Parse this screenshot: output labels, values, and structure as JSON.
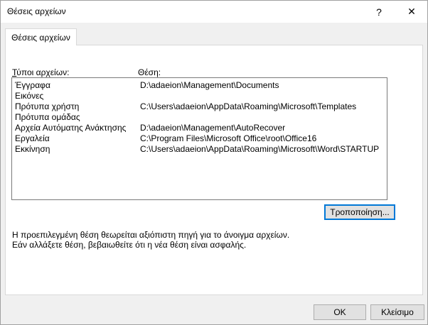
{
  "window": {
    "title": "Θέσεις αρχείων",
    "help_glyph": "?",
    "close_glyph": "✕"
  },
  "tab": {
    "label": "Θέσεις αρχείων"
  },
  "columns": {
    "types_label_first": "Τ",
    "types_label_rest": "ύποι αρχείων:",
    "location_label": "Θέση:"
  },
  "rows": [
    {
      "type": "Έγγραφα",
      "location": "D:\\adaeion\\Management\\Documents"
    },
    {
      "type": "Εικόνες",
      "location": ""
    },
    {
      "type": "Πρότυπα χρήστη",
      "location": "C:\\Users\\adaeion\\AppData\\Roaming\\Microsoft\\Templates"
    },
    {
      "type": "Πρότυπα ομάδας",
      "location": ""
    },
    {
      "type": "Αρχεία Αυτόματης Ανάκτησης",
      "location": "D:\\adaeion\\Management\\AutoRecover"
    },
    {
      "type": "Εργαλεία",
      "location": "C:\\Program Files\\Microsoft Office\\root\\Office16"
    },
    {
      "type": "Εκκίνηση",
      "location": "C:\\Users\\adaeion\\AppData\\Roaming\\Microsoft\\Word\\STARTUP"
    }
  ],
  "buttons": {
    "modify": "Τροποποίηση...",
    "ok": "OK",
    "close": "Κλείσιμο"
  },
  "info": {
    "line1": "Η προεπιλεγμένη θέση θεωρείται αξιόπιστη πηγή για το άνοιγμα αρχείων.",
    "line2": "Εάν αλλάξετε θέση, βεβαιωθείτε ότι η νέα θέση είναι ασφαλής."
  },
  "colors": {
    "accent": "#0078d7",
    "dialog_bg": "#f0f0f0",
    "button_bg": "#e1e1e1"
  }
}
